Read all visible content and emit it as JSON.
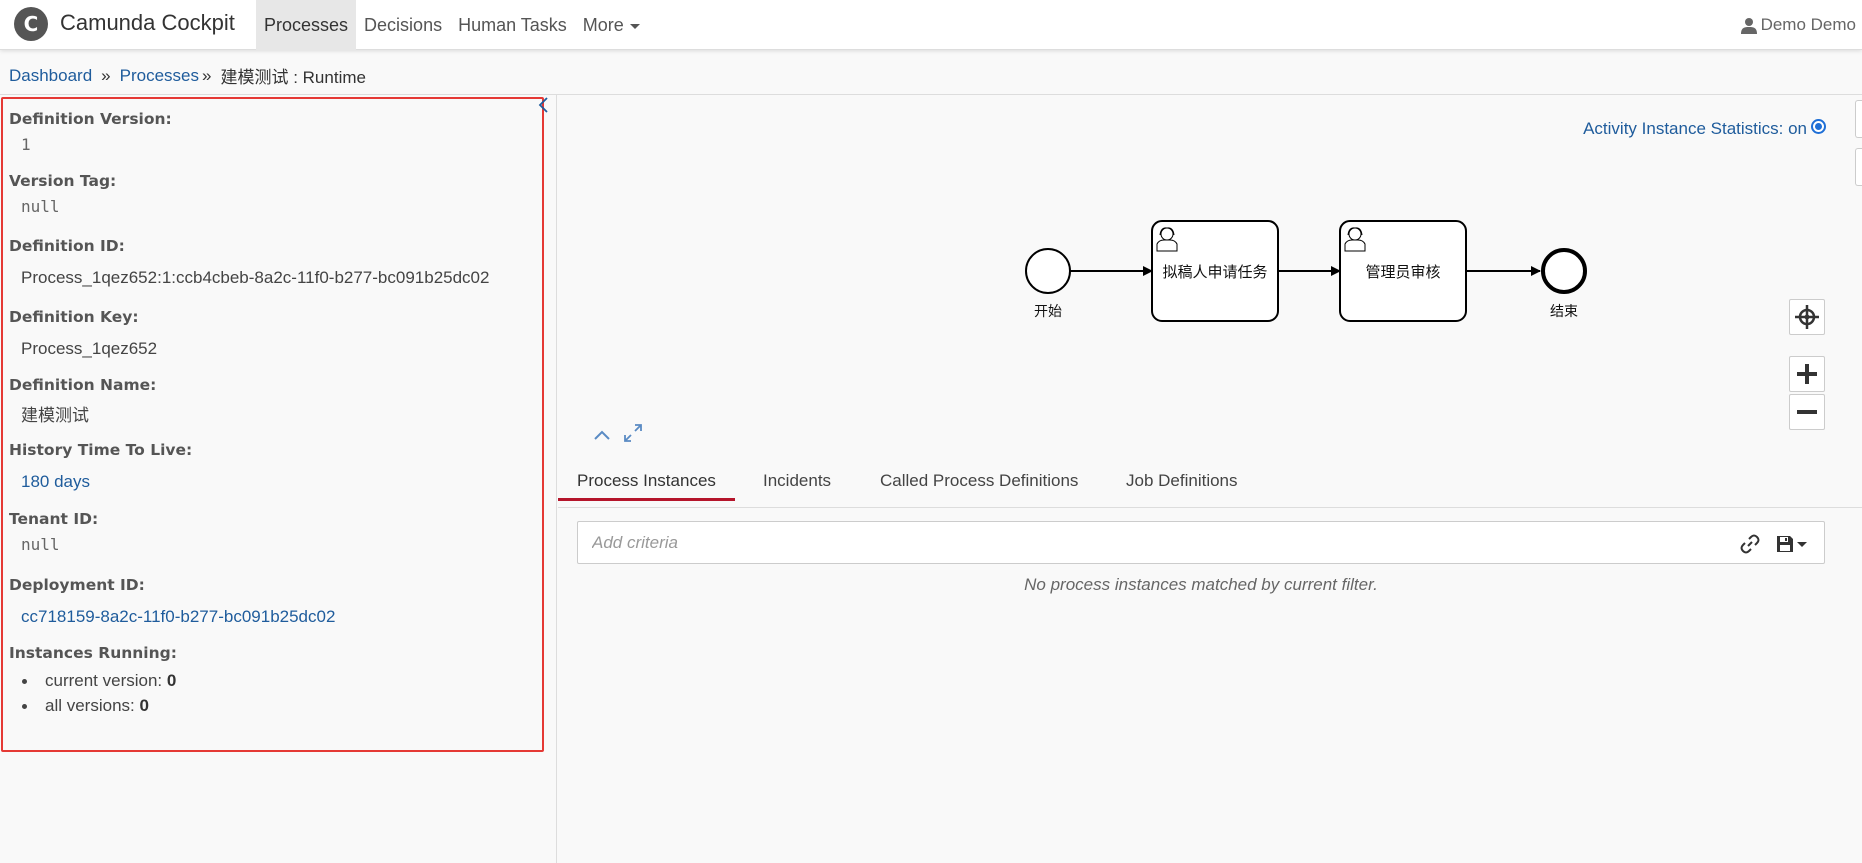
{
  "app": {
    "logo_letter": "C",
    "name": "Camunda Cockpit"
  },
  "nav": {
    "items": [
      {
        "label": "Processes",
        "active": true
      },
      {
        "label": "Decisions",
        "active": false
      },
      {
        "label": "Human Tasks",
        "active": false
      },
      {
        "label": "More",
        "active": false
      }
    ],
    "user": "Demo Demo"
  },
  "breadcrumb": {
    "dashboard": "Dashboard",
    "processes": "Processes",
    "separator": "»",
    "current": "建模测试 : Runtime"
  },
  "details": {
    "definition_version": {
      "label": "Definition Version:",
      "value": "1"
    },
    "version_tag": {
      "label": "Version Tag:",
      "value": "null"
    },
    "definition_id": {
      "label": "Definition ID:",
      "value": "Process_1qez652:1:ccb4cbeb-8a2c-11f0-b277-bc091b25dc02"
    },
    "definition_key": {
      "label": "Definition Key:",
      "value": "Process_1qez652"
    },
    "definition_name": {
      "label": "Definition Name:",
      "value": "建模测试"
    },
    "history_ttl": {
      "label": "History Time To Live:",
      "value": "180 days"
    },
    "tenant_id": {
      "label": "Tenant ID:",
      "value": "null"
    },
    "deployment_id": {
      "label": "Deployment ID:",
      "value": "cc718159-8a2c-11f0-b277-bc091b25dc02"
    },
    "instances_running": {
      "label": "Instances Running:",
      "current_label": "current version:",
      "current_value": "0",
      "all_label": "all versions:",
      "all_value": "0"
    }
  },
  "diagram": {
    "stats_label": "Activity Instance Statistics: on",
    "start_event": "开始",
    "task1": "拟稿人申请任务",
    "task2": "管理员审核",
    "end_event": "结束"
  },
  "tabs": [
    {
      "label": "Process Instances",
      "active": true
    },
    {
      "label": "Incidents",
      "active": false
    },
    {
      "label": "Called Process Definitions",
      "active": false
    },
    {
      "label": "Job Definitions",
      "active": false
    }
  ],
  "search": {
    "placeholder": "Add criteria",
    "empty_message": "No process instances matched by current filter."
  },
  "colors": {
    "link": "#1f5c9c",
    "active_tab_underline": "#b5152b",
    "highlight_border": "#e53935"
  }
}
